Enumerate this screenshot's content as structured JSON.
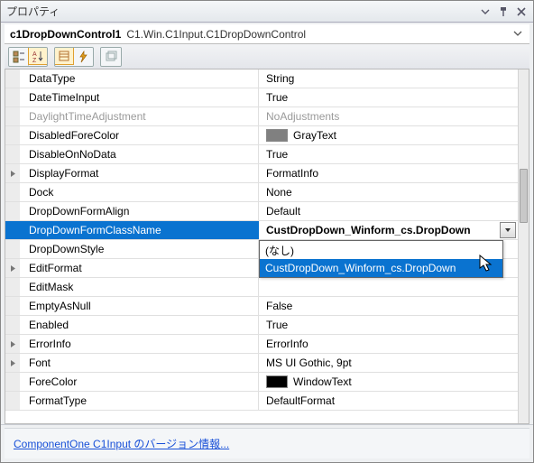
{
  "window_title": "プロパティ",
  "selector": {
    "name": "c1DropDownControl1",
    "type": "C1.Win.C1Input.C1DropDownControl"
  },
  "selected_property": "DropDownFormClassName",
  "selected_value": "CustDropDown_Winform_cs.DropDown",
  "dropdown_options": [
    {
      "label": "(なし)",
      "selected": false
    },
    {
      "label": "CustDropDown_Winform_cs.DropDown",
      "selected": true
    }
  ],
  "properties": [
    {
      "name": "DataType",
      "value": "String"
    },
    {
      "name": "DateTimeInput",
      "value": "True"
    },
    {
      "name": "DaylightTimeAdjustment",
      "value": "NoAdjustments",
      "disabled": true
    },
    {
      "name": "DisabledForeColor",
      "value": "GrayText",
      "color": "#808080"
    },
    {
      "name": "DisableOnNoData",
      "value": "True"
    },
    {
      "name": "DisplayFormat",
      "value": "FormatInfo",
      "expandable": true
    },
    {
      "name": "Dock",
      "value": "None"
    },
    {
      "name": "DropDownFormAlign",
      "value": "Default"
    },
    {
      "name": "DropDownFormClassName",
      "value": "CustDropDown_Winform_cs.DropDown",
      "selected": true
    },
    {
      "name": "DropDownStyle",
      "value": ""
    },
    {
      "name": "EditFormat",
      "value": "",
      "expandable": true
    },
    {
      "name": "EditMask",
      "value": ""
    },
    {
      "name": "EmptyAsNull",
      "value": "False"
    },
    {
      "name": "Enabled",
      "value": "True"
    },
    {
      "name": "ErrorInfo",
      "value": "ErrorInfo",
      "expandable": true
    },
    {
      "name": "Font",
      "value": "MS UI Gothic, 9pt",
      "expandable": true
    },
    {
      "name": "ForeColor",
      "value": "WindowText",
      "color": "#000000"
    },
    {
      "name": "FormatType",
      "value": "DefaultFormat"
    }
  ],
  "footer_link": "ComponentOne C1Input のバージョン情報..."
}
